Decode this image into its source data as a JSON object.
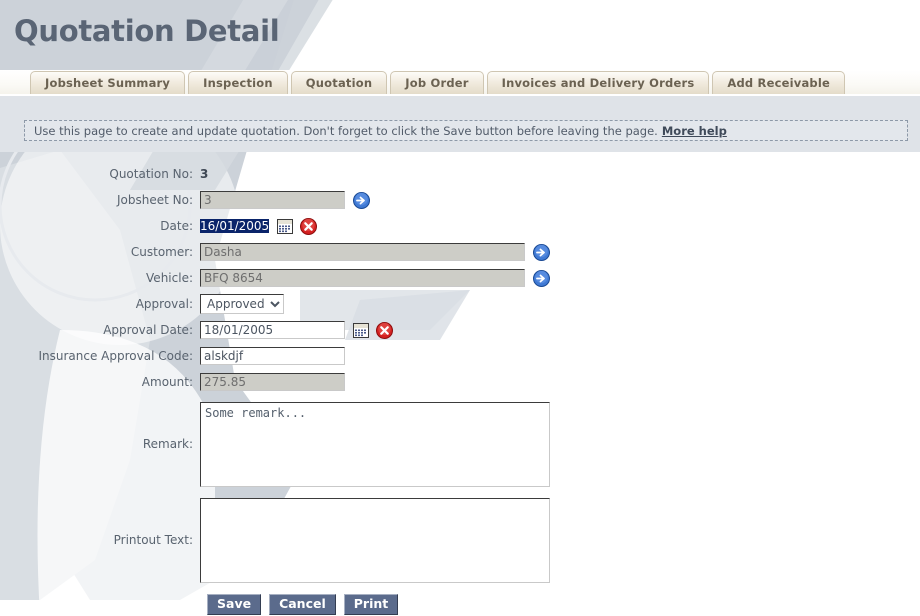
{
  "page": {
    "title": "Quotation Detail"
  },
  "tabs": [
    {
      "label": "Jobsheet Summary",
      "name": "tab-jobsheet-summary"
    },
    {
      "label": "Inspection",
      "name": "tab-inspection"
    },
    {
      "label": "Quotation",
      "name": "tab-quotation"
    },
    {
      "label": "Job Order",
      "name": "tab-job-order"
    },
    {
      "label": "Invoices and Delivery Orders",
      "name": "tab-invoices-and-delivery-orders"
    },
    {
      "label": "Add Receivable",
      "name": "tab-add-receivable"
    }
  ],
  "help_banner": {
    "text": "Use this page to create and update quotation. Don't forget to click the Save button before leaving the page.",
    "link_label": "More help"
  },
  "form": {
    "quotation_no": {
      "label": "Quotation No:",
      "value": "3"
    },
    "jobsheet_no": {
      "label": "Jobsheet No:",
      "value": "3",
      "placeholder": ""
    },
    "date": {
      "label": "Date:",
      "value": "16/01/2005",
      "placeholder": ""
    },
    "customer": {
      "label": "Customer:",
      "value": "Dasha",
      "placeholder": ""
    },
    "vehicle": {
      "label": "Vehicle:",
      "value": "BFQ 8654",
      "placeholder": ""
    },
    "approval": {
      "label": "Approval:",
      "selected": "Approved",
      "options": [
        "Approved"
      ]
    },
    "approval_date": {
      "label": "Approval Date:",
      "value": "18/01/2005",
      "placeholder": ""
    },
    "insurance_approval_code": {
      "label": "Insurance Approval Code:",
      "value": "alskdjf",
      "placeholder": ""
    },
    "amount": {
      "label": "Amount:",
      "value": "275.85",
      "placeholder": ""
    },
    "remark": {
      "label": "Remark:",
      "value": "Some remark...",
      "placeholder": ""
    },
    "printout_text": {
      "label": "Printout Text:",
      "value": "",
      "placeholder": ""
    }
  },
  "icons": {
    "goto_jobsheet": "blue-arrow-icon",
    "goto_customer": "blue-arrow-icon",
    "goto_vehicle": "blue-arrow-icon",
    "date_picker": "calendar-icon",
    "date_clear": "red-delete-icon",
    "approval_date_picker": "calendar-icon",
    "approval_date_clear": "red-delete-icon"
  },
  "buttons": {
    "save": "Save",
    "cancel": "Cancel",
    "print": "Print"
  },
  "colors": {
    "title": "#5a6575",
    "tab_text": "#6b6252",
    "banner_bg": "#e3e7ec",
    "button_bg": "#5b6b8c",
    "focus_border": "#e8a33d",
    "selection_bg": "#0a246a"
  }
}
